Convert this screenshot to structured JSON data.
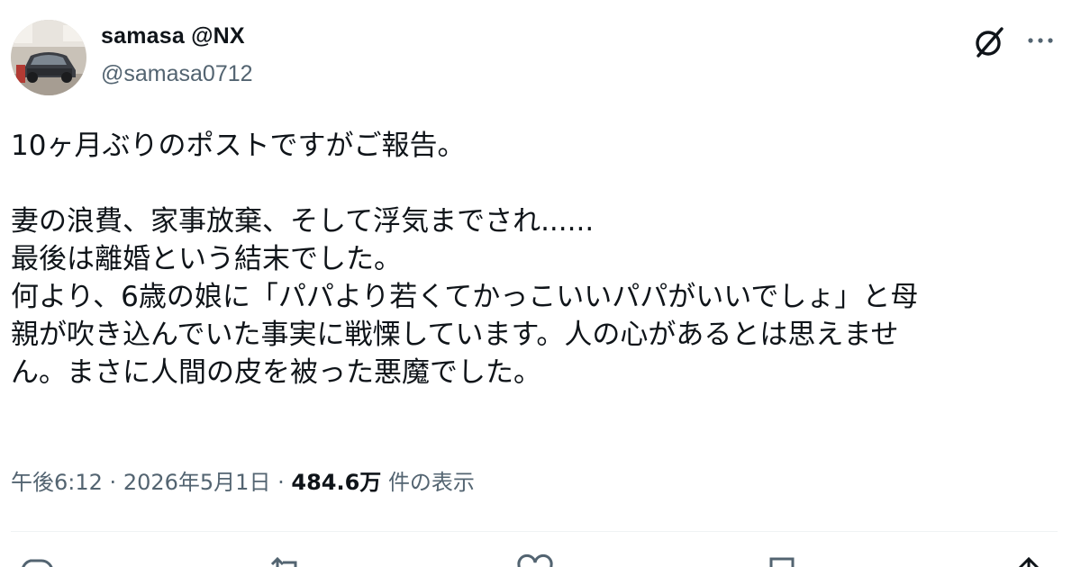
{
  "author": {
    "display_name": "samasa @NX",
    "handle": "@samasa0712",
    "avatar": "profile-photo-car"
  },
  "header_icons": {
    "grok": "grok-icon",
    "more": "more-icon"
  },
  "post": {
    "lines": [
      "10ヶ月ぶりのポストですがご報告。",
      "",
      "妻の浪費、家事放棄、そして浮気までされ......",
      "最後は離婚という結末でした。",
      "何より、6歳の娘に「パパより若くてかっこいいパパがいいでしょ」と母",
      "親が吹き込んでいた事実に戦慄しています。人の心があるとは思えませ",
      "ん。まさに人間の皮を被った悪魔でした。"
    ]
  },
  "meta": {
    "time": "午後6:12",
    "separator": "·",
    "date": "2026年5月1日",
    "views_count": "484.6万",
    "views_label": "件の表示"
  },
  "actions": {
    "reply_icon": "reply-icon",
    "repost_icon": "repost-icon",
    "like_icon": "like-icon",
    "bookmark_icon": "bookmark-icon",
    "share_icon": "share-icon"
  },
  "colors": {
    "text_primary": "#0f1419",
    "text_secondary": "#536471",
    "divider": "#eff3f4"
  }
}
